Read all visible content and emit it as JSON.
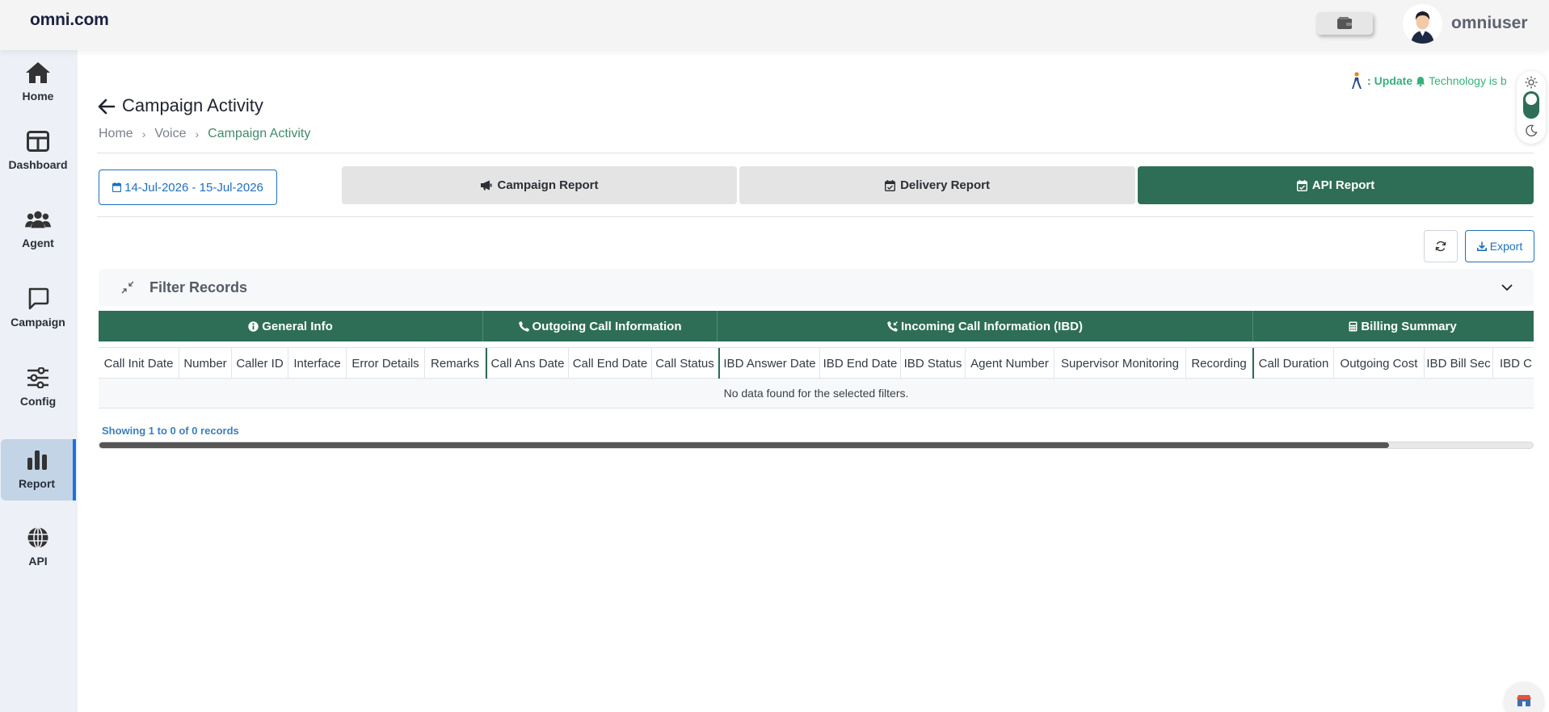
{
  "header": {
    "brand": "omni.com",
    "username": "omniuser"
  },
  "sidebar": {
    "items": [
      {
        "label": "Home",
        "icon": "home-icon"
      },
      {
        "label": "Dashboard",
        "icon": "dashboard-icon"
      },
      {
        "label": "Agent",
        "icon": "agent-icon"
      },
      {
        "label": "Campaign",
        "icon": "chat-icon"
      },
      {
        "label": "Config",
        "icon": "sliders-icon"
      },
      {
        "label": "Report",
        "icon": "bar-chart-icon",
        "active": true
      },
      {
        "label": "API",
        "icon": "globe-icon"
      }
    ]
  },
  "ticker": {
    "colon": ":",
    "update": "Update",
    "text": "Technology is b"
  },
  "page": {
    "title": "Campaign Activity",
    "breadcrumb": [
      "Home",
      "Voice",
      "Campaign Activity"
    ]
  },
  "date_range": "14-Jul-2026 - 15-Jul-2026",
  "tabs": [
    {
      "label": "Campaign Report",
      "icon": "megaphone-icon"
    },
    {
      "label": "Delivery Report",
      "icon": "calendar-check-icon"
    },
    {
      "label": "API Report",
      "icon": "calendar-check-icon",
      "active": true
    }
  ],
  "actions": {
    "export_label": "Export"
  },
  "filter": {
    "title": "Filter Records"
  },
  "table": {
    "groups": [
      {
        "label": "General Info",
        "icon": "info-icon"
      },
      {
        "label": "Outgoing Call Information",
        "icon": "phone-icon"
      },
      {
        "label": "Incoming Call Information (IBD)",
        "icon": "phone-incoming-icon"
      },
      {
        "label": "Billing Summary",
        "icon": "calculator-icon"
      }
    ],
    "columns": [
      "Call Init Date",
      "Number",
      "Caller ID",
      "Interface",
      "Error Details",
      "Remarks",
      "Call Ans Date",
      "Call End Date",
      "Call Status",
      "IBD Answer Date",
      "IBD End Date",
      "IBD Status",
      "Agent Number",
      "Supervisor Monitoring",
      "Recording",
      "Call Duration",
      "Outgoing Cost",
      "IBD Bill Sec",
      "IBD C"
    ],
    "empty_message": "No data found for the selected filters."
  },
  "pagination": {
    "showing": "Showing 1 to 0 of 0 records"
  },
  "colors": {
    "accent": "#2e6e57",
    "link": "#1f6fbf"
  }
}
